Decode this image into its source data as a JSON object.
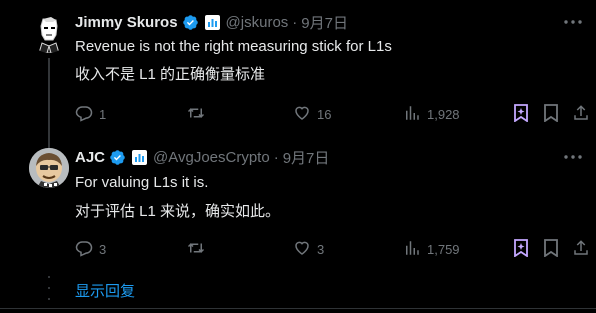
{
  "tweets": [
    {
      "author": {
        "name": "Jimmy Skuros",
        "handle": "@jskuros",
        "separator": "·",
        "date": "9月7日"
      },
      "lines": [
        "Revenue is not the right measuring stick for L1s",
        "收入不是 L1 的正确衡量标准"
      ],
      "stats": {
        "replies": "1",
        "retweets": "",
        "likes": "16",
        "views": "1,928"
      }
    },
    {
      "author": {
        "name": "AJC",
        "handle": "@AvgJoesCrypto",
        "separator": "·",
        "date": "9月7日"
      },
      "lines": [
        "For valuing L1s it is.",
        "对于评估 L1 来说，确实如此。"
      ],
      "stats": {
        "replies": "3",
        "retweets": "",
        "likes": "3",
        "views": "1,759"
      }
    }
  ],
  "footer": {
    "show_replies": "显示回复"
  },
  "colors": {
    "background": "#000000",
    "text": "#e7e9ea",
    "secondary": "#71767b",
    "accent": "#1d9bf0",
    "grok_purple": "#c4a8ff"
  },
  "icons": [
    "verified-icon",
    "affiliate-icon",
    "more-icon",
    "reply-icon",
    "retweet-icon",
    "like-icon",
    "views-icon",
    "grok-bookmark-icon",
    "bookmark-icon",
    "share-icon"
  ]
}
